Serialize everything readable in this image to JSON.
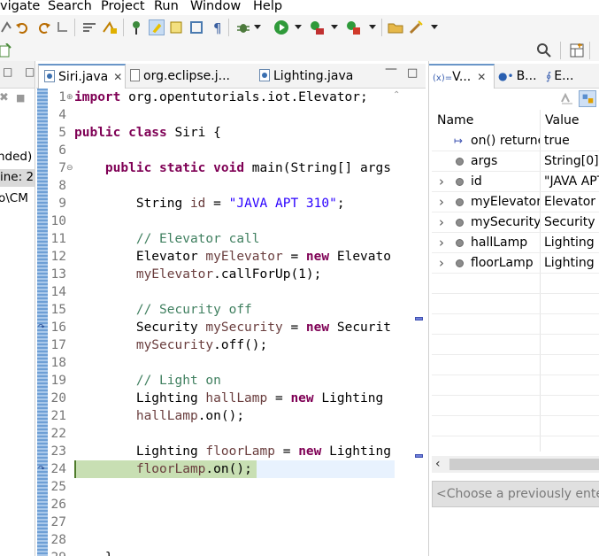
{
  "menu": [
    "vigate",
    "Search",
    "Project",
    "Run",
    "Window",
    "Help"
  ],
  "left_view": {
    "lines": [
      "nded)",
      "ine: 2",
      "o\\CM"
    ]
  },
  "editor": {
    "tabs": [
      {
        "label": "Siri.java",
        "close": "✕"
      },
      {
        "label": "org.eclipse.j..."
      },
      {
        "label": "Lighting.java"
      }
    ],
    "lines": [
      {
        "n": "1",
        "fold": "⊕",
        "parts": [
          [
            "kw",
            "import"
          ],
          [
            "",
            " org.opentutorials.iot.Elevator;"
          ]
        ]
      },
      {
        "n": "4",
        "parts": []
      },
      {
        "n": "5",
        "parts": [
          [
            "kw",
            "public class"
          ],
          [
            "",
            " Siri {"
          ]
        ]
      },
      {
        "n": "6",
        "parts": []
      },
      {
        "n": "7",
        "fold": "⊖",
        "parts": [
          [
            "",
            "    "
          ],
          [
            "kw",
            "public static void"
          ],
          [
            "",
            " main(String[] args"
          ]
        ]
      },
      {
        "n": "8",
        "parts": []
      },
      {
        "n": "9",
        "parts": [
          [
            "",
            "        String "
          ],
          [
            "var",
            "id"
          ],
          [
            "",
            " = "
          ],
          [
            "str",
            "\"JAVA APT 310\""
          ],
          [
            "",
            ";"
          ]
        ]
      },
      {
        "n": "10",
        "parts": []
      },
      {
        "n": "11",
        "parts": [
          [
            "",
            "        "
          ],
          [
            "cmt",
            "// Elevator call"
          ]
        ]
      },
      {
        "n": "12",
        "parts": [
          [
            "",
            "        Elevator "
          ],
          [
            "var",
            "myElevator"
          ],
          [
            "",
            " = "
          ],
          [
            "kw",
            "new"
          ],
          [
            "",
            " Elevato"
          ]
        ]
      },
      {
        "n": "13",
        "parts": [
          [
            "",
            "        "
          ],
          [
            "var",
            "myElevator"
          ],
          [
            "",
            ".callForUp(1);"
          ]
        ]
      },
      {
        "n": "14",
        "parts": []
      },
      {
        "n": "15",
        "parts": [
          [
            "",
            "        "
          ],
          [
            "cmt",
            "// Security off"
          ]
        ]
      },
      {
        "n": "16",
        "parts": [
          [
            "",
            "        Security "
          ],
          [
            "var",
            "mySecurity"
          ],
          [
            "",
            " = "
          ],
          [
            "kw",
            "new"
          ],
          [
            "",
            " Securit"
          ]
        ]
      },
      {
        "n": "17",
        "parts": [
          [
            "",
            "        "
          ],
          [
            "var",
            "mySecurity"
          ],
          [
            "",
            ".off();"
          ]
        ]
      },
      {
        "n": "18",
        "parts": []
      },
      {
        "n": "19",
        "parts": [
          [
            "",
            "        "
          ],
          [
            "cmt",
            "// Light on"
          ]
        ]
      },
      {
        "n": "20",
        "parts": [
          [
            "",
            "        Lighting "
          ],
          [
            "var",
            "hallLamp"
          ],
          [
            "",
            " = "
          ],
          [
            "kw",
            "new"
          ],
          [
            "",
            " Lighting"
          ]
        ]
      },
      {
        "n": "21",
        "parts": [
          [
            "",
            "        "
          ],
          [
            "var",
            "hallLamp"
          ],
          [
            "",
            ".on();"
          ]
        ]
      },
      {
        "n": "22",
        "parts": []
      },
      {
        "n": "23",
        "parts": [
          [
            "",
            "        Lighting "
          ],
          [
            "var",
            "floorLamp"
          ],
          [
            "",
            " = "
          ],
          [
            "kw",
            "new"
          ],
          [
            "",
            " Lighting"
          ]
        ]
      },
      {
        "n": "24",
        "parts": [
          [
            "",
            "        "
          ],
          [
            "var",
            "floorLamp"
          ],
          [
            "",
            ".on();"
          ]
        ]
      },
      {
        "n": "25",
        "parts": []
      },
      {
        "n": "26",
        "parts": []
      },
      {
        "n": "27",
        "parts": []
      },
      {
        "n": "28",
        "parts": []
      },
      {
        "n": "29",
        "parts": [
          [
            "",
            "    }"
          ]
        ]
      }
    ]
  },
  "variables_view": {
    "tabs": [
      {
        "label": "V...",
        "prefix": "(x)="
      },
      {
        "label": "B..."
      },
      {
        "label": "E..."
      }
    ],
    "columns": {
      "name": "Name",
      "value": "Value"
    },
    "rows": [
      {
        "kind": "return",
        "expandable": false,
        "name": "on() returne",
        "value": "true"
      },
      {
        "kind": "local",
        "expandable": false,
        "name": "args",
        "value": "String[0]"
      },
      {
        "kind": "local",
        "expandable": true,
        "name": "id",
        "value": "\"JAVA APT"
      },
      {
        "kind": "local",
        "expandable": true,
        "name": "myElevator",
        "value": "Elevator"
      },
      {
        "kind": "local",
        "expandable": true,
        "name": "mySecurity",
        "value": "Security"
      },
      {
        "kind": "local",
        "expandable": true,
        "name": "hallLamp",
        "value": "Lighting"
      },
      {
        "kind": "local",
        "expandable": true,
        "name": "floorLamp",
        "value": "Lighting"
      }
    ],
    "detail_placeholder": "<Choose a previously enter"
  },
  "colors": {
    "keyword": "#7f0055",
    "string": "#2a00ff",
    "comment": "#3f7f5f",
    "local_var": "#6a3e3e",
    "debug_line": "#c8dfb3",
    "current_line": "#e8f2fe",
    "overview_marker": "#6f7fd9"
  }
}
